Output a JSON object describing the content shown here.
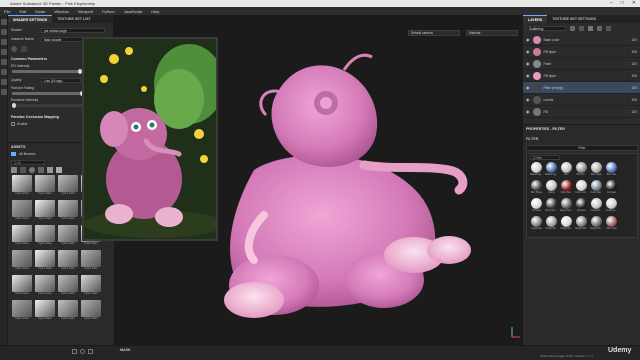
{
  "window": {
    "title": "Adobe Substance 3D Painter - Pink Elephantnip"
  },
  "menu": [
    "File",
    "Edit",
    "Mode",
    "Window",
    "Viewport",
    "Python",
    "JavaScript",
    "Help"
  ],
  "left_panel": {
    "tabs": [
      "SHADER SETTINGS",
      "TEXTURE SET LIST"
    ],
    "shader_label": "Shader",
    "shader_value": "pbr-metal-rough",
    "instance_label": "Instance Name",
    "instance_value": "Main shader",
    "common_section": "Common Parameters",
    "emissive_label": "EO Intensity",
    "quality_label": "Quality",
    "quality_value": "Low (16 spp)",
    "horizon_label": "Horizon Fading",
    "intensity_label": "Emissive Intensity",
    "parallax_section": "Parallax Occlusion Mapping",
    "enable_label": "Enable",
    "assets_title": "ASSETS",
    "libraries_label": "All libraries",
    "search_placeholder": "Q All",
    "assets": [
      {
        "label": "Kyle's Paint"
      },
      {
        "label": "Kyle's Paint"
      },
      {
        "label": "Kyle's Paint"
      },
      {
        "label": "Kyle's Paint"
      },
      {
        "label": "Kyle's Paint"
      },
      {
        "label": "Kyle's Paint"
      },
      {
        "label": "Kyle's Paint"
      },
      {
        "label": "Kyle's Paint"
      },
      {
        "label": "Kyle's Paint"
      },
      {
        "label": "Kyle's Paint"
      },
      {
        "label": "Kyle's Paint"
      },
      {
        "label": "Kyle's Paint"
      },
      {
        "label": "Kyle's Paint"
      },
      {
        "label": "Kyle's Paint"
      },
      {
        "label": "Kyle's Paint"
      },
      {
        "label": "Kyle's Paint"
      },
      {
        "label": "Kyle's Paint"
      },
      {
        "label": "Kyle's Paint"
      },
      {
        "label": "Kyle's Paint"
      },
      {
        "label": "Kyle's Paint"
      },
      {
        "label": "Kyle's Paint"
      },
      {
        "label": "Kyle's Paint"
      },
      {
        "label": "Kyle's Paint"
      },
      {
        "label": "Kyle's Paint"
      }
    ]
  },
  "viewport": {
    "camera_dropdown": "Default camera",
    "channel_dropdown": "Material",
    "bottom_label": "MASK"
  },
  "right_panel": {
    "tabs": [
      "LAYERS",
      "TEXTURE SET SETTINGS"
    ],
    "blend_mode": "Scattering",
    "layers": [
      {
        "name": "Base color",
        "opacity": "100",
        "thumb": "#d98ab4"
      },
      {
        "name": "Fill layer",
        "opacity": "100",
        "thumb": "#c8799f"
      },
      {
        "name": "Paint",
        "opacity": "100",
        "thumb": "#888888"
      },
      {
        "name": "Fill layer",
        "opacity": "100",
        "thumb": "#e79cc2"
      },
      {
        "name": "Filter (empty)",
        "opacity": "100",
        "thumb": "#444444"
      },
      {
        "name": "Levels",
        "opacity": "100",
        "thumb": "#555555"
      },
      {
        "name": "Fill",
        "opacity": "100",
        "thumb": "#777777"
      }
    ],
    "properties_title": "PROPERTIES - FILTER",
    "filter_title": "FILTER",
    "filter_select_label": "Filter",
    "filter_search": "Q filter",
    "filters": [
      {
        "label": "Baked Lig...",
        "color": "#cfcfcf"
      },
      {
        "label": "Baked Lig...",
        "color": "#3c6fa8"
      },
      {
        "label": "Blur",
        "color": "#bdbdbd"
      },
      {
        "label": "Blur Dir...",
        "color": "#8a8a8a"
      },
      {
        "label": "Blur Slope",
        "color": "#a9a9a9"
      },
      {
        "label": "Blur Hue",
        "color": "#4a6fbf"
      },
      {
        "label": "Blur Sharp",
        "color": "#444444"
      },
      {
        "label": "Clamp",
        "color": "#c0c0c0"
      },
      {
        "label": "Color Bal...",
        "color": "#8b1c1c"
      },
      {
        "label": "Color Corr...",
        "color": "#d0d0d0"
      },
      {
        "label": "Color Mat...",
        "color": "#6a7a8a"
      },
      {
        "label": "Contrast",
        "color": "#1c1c1c"
      },
      {
        "label": "Contrast",
        "color": "#d8d8d8"
      },
      {
        "label": "Direct De...",
        "color": "#3a3a3a"
      },
      {
        "label": "Edge Dete...",
        "color": "#606060"
      },
      {
        "label": "Emboss",
        "color": "#202020"
      },
      {
        "label": "Gradient...",
        "color": "#c3c3c3"
      },
      {
        "label": "Gradient...",
        "color": "#cccccc"
      },
      {
        "label": "Grayscale",
        "color": "#808080"
      },
      {
        "label": "Height Bl...",
        "color": "#9a9a9a"
      },
      {
        "label": "Height Bl...",
        "color": "#d5d5d5"
      },
      {
        "label": "Height Ma...",
        "color": "#7d7d7d"
      },
      {
        "label": "Height Mo...",
        "color": "#6c6c6c"
      },
      {
        "label": "HSL Color",
        "color": "#9c5c5c"
      }
    ]
  },
  "status": {
    "text": "Cache Disk Usage: 97% | Version: 7.x.x",
    "brand": "Udemy"
  }
}
